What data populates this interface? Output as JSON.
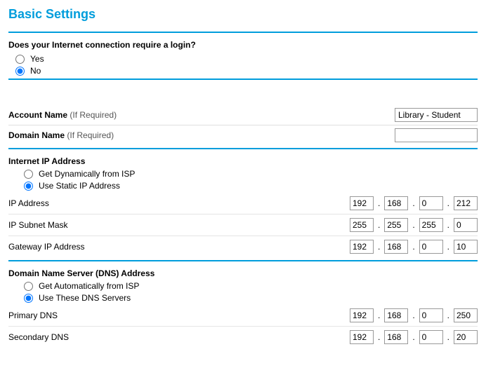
{
  "title": "Basic Settings",
  "login_q": "Does your Internet connection require a login?",
  "login_yes": "Yes",
  "login_no": "No",
  "login_selected": "no",
  "account_name_label": "Account Name",
  "if_required": "(If Required)",
  "account_name_value": "Library - Student",
  "domain_name_label": "Domain Name",
  "domain_name_value": "",
  "ip_section": "Internet IP Address",
  "ip_dynamic": "Get Dynamically from ISP",
  "ip_static": "Use Static IP Address",
  "ip_mode_selected": "static",
  "ip_address_label": "IP Address",
  "ip_address": {
    "a": "192",
    "b": "168",
    "c": "0",
    "d": "212"
  },
  "subnet_label": "IP Subnet Mask",
  "subnet": {
    "a": "255",
    "b": "255",
    "c": "255",
    "d": "0"
  },
  "gateway_label": "Gateway IP Address",
  "gateway": {
    "a": "192",
    "b": "168",
    "c": "0",
    "d": "10"
  },
  "dns_section": "Domain Name Server (DNS) Address",
  "dns_auto": "Get Automatically from ISP",
  "dns_manual": "Use These DNS Servers",
  "dns_mode_selected": "manual",
  "primary_dns_label": "Primary DNS",
  "primary_dns": {
    "a": "192",
    "b": "168",
    "c": "0",
    "d": "250"
  },
  "secondary_dns_label": "Secondary DNS",
  "secondary_dns": {
    "a": "192",
    "b": "168",
    "c": "0",
    "d": "20"
  },
  "dot": ".",
  "colors": {
    "accent": "#009ddc"
  }
}
